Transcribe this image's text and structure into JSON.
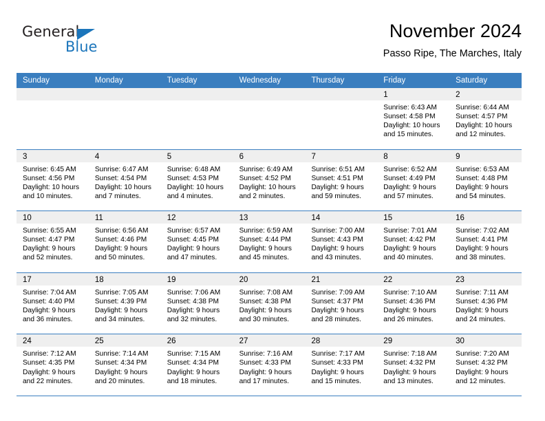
{
  "brand": {
    "word_one": "General",
    "word_two": "Blue",
    "triangle_icon": "triangle-icon",
    "accent_color": "#1b75bb"
  },
  "header": {
    "title": "November 2024",
    "subtitle": "Passo Ripe, The Marches, Italy"
  },
  "colors": {
    "header_band": "#3a7ebf",
    "day_number_band": "#efefef",
    "grid_line": "#3a7ebf",
    "text": "#000000"
  },
  "calendar": {
    "weekday_headers": [
      "Sunday",
      "Monday",
      "Tuesday",
      "Wednesday",
      "Thursday",
      "Friday",
      "Saturday"
    ],
    "weeks": [
      [
        {
          "date": "",
          "sunrise": "",
          "sunset": "",
          "daylight_line1": "",
          "daylight_line2": "",
          "empty": true
        },
        {
          "date": "",
          "sunrise": "",
          "sunset": "",
          "daylight_line1": "",
          "daylight_line2": "",
          "empty": true
        },
        {
          "date": "",
          "sunrise": "",
          "sunset": "",
          "daylight_line1": "",
          "daylight_line2": "",
          "empty": true
        },
        {
          "date": "",
          "sunrise": "",
          "sunset": "",
          "daylight_line1": "",
          "daylight_line2": "",
          "empty": true
        },
        {
          "date": "",
          "sunrise": "",
          "sunset": "",
          "daylight_line1": "",
          "daylight_line2": "",
          "empty": true
        },
        {
          "date": "1",
          "sunrise": "Sunrise: 6:43 AM",
          "sunset": "Sunset: 4:58 PM",
          "daylight_line1": "Daylight: 10 hours",
          "daylight_line2": "and 15 minutes.",
          "empty": false
        },
        {
          "date": "2",
          "sunrise": "Sunrise: 6:44 AM",
          "sunset": "Sunset: 4:57 PM",
          "daylight_line1": "Daylight: 10 hours",
          "daylight_line2": "and 12 minutes.",
          "empty": false
        }
      ],
      [
        {
          "date": "3",
          "sunrise": "Sunrise: 6:45 AM",
          "sunset": "Sunset: 4:56 PM",
          "daylight_line1": "Daylight: 10 hours",
          "daylight_line2": "and 10 minutes.",
          "empty": false
        },
        {
          "date": "4",
          "sunrise": "Sunrise: 6:47 AM",
          "sunset": "Sunset: 4:54 PM",
          "daylight_line1": "Daylight: 10 hours",
          "daylight_line2": "and 7 minutes.",
          "empty": false
        },
        {
          "date": "5",
          "sunrise": "Sunrise: 6:48 AM",
          "sunset": "Sunset: 4:53 PM",
          "daylight_line1": "Daylight: 10 hours",
          "daylight_line2": "and 4 minutes.",
          "empty": false
        },
        {
          "date": "6",
          "sunrise": "Sunrise: 6:49 AM",
          "sunset": "Sunset: 4:52 PM",
          "daylight_line1": "Daylight: 10 hours",
          "daylight_line2": "and 2 minutes.",
          "empty": false
        },
        {
          "date": "7",
          "sunrise": "Sunrise: 6:51 AM",
          "sunset": "Sunset: 4:51 PM",
          "daylight_line1": "Daylight: 9 hours",
          "daylight_line2": "and 59 minutes.",
          "empty": false
        },
        {
          "date": "8",
          "sunrise": "Sunrise: 6:52 AM",
          "sunset": "Sunset: 4:49 PM",
          "daylight_line1": "Daylight: 9 hours",
          "daylight_line2": "and 57 minutes.",
          "empty": false
        },
        {
          "date": "9",
          "sunrise": "Sunrise: 6:53 AM",
          "sunset": "Sunset: 4:48 PM",
          "daylight_line1": "Daylight: 9 hours",
          "daylight_line2": "and 54 minutes.",
          "empty": false
        }
      ],
      [
        {
          "date": "10",
          "sunrise": "Sunrise: 6:55 AM",
          "sunset": "Sunset: 4:47 PM",
          "daylight_line1": "Daylight: 9 hours",
          "daylight_line2": "and 52 minutes.",
          "empty": false
        },
        {
          "date": "11",
          "sunrise": "Sunrise: 6:56 AM",
          "sunset": "Sunset: 4:46 PM",
          "daylight_line1": "Daylight: 9 hours",
          "daylight_line2": "and 50 minutes.",
          "empty": false
        },
        {
          "date": "12",
          "sunrise": "Sunrise: 6:57 AM",
          "sunset": "Sunset: 4:45 PM",
          "daylight_line1": "Daylight: 9 hours",
          "daylight_line2": "and 47 minutes.",
          "empty": false
        },
        {
          "date": "13",
          "sunrise": "Sunrise: 6:59 AM",
          "sunset": "Sunset: 4:44 PM",
          "daylight_line1": "Daylight: 9 hours",
          "daylight_line2": "and 45 minutes.",
          "empty": false
        },
        {
          "date": "14",
          "sunrise": "Sunrise: 7:00 AM",
          "sunset": "Sunset: 4:43 PM",
          "daylight_line1": "Daylight: 9 hours",
          "daylight_line2": "and 43 minutes.",
          "empty": false
        },
        {
          "date": "15",
          "sunrise": "Sunrise: 7:01 AM",
          "sunset": "Sunset: 4:42 PM",
          "daylight_line1": "Daylight: 9 hours",
          "daylight_line2": "and 40 minutes.",
          "empty": false
        },
        {
          "date": "16",
          "sunrise": "Sunrise: 7:02 AM",
          "sunset": "Sunset: 4:41 PM",
          "daylight_line1": "Daylight: 9 hours",
          "daylight_line2": "and 38 minutes.",
          "empty": false
        }
      ],
      [
        {
          "date": "17",
          "sunrise": "Sunrise: 7:04 AM",
          "sunset": "Sunset: 4:40 PM",
          "daylight_line1": "Daylight: 9 hours",
          "daylight_line2": "and 36 minutes.",
          "empty": false
        },
        {
          "date": "18",
          "sunrise": "Sunrise: 7:05 AM",
          "sunset": "Sunset: 4:39 PM",
          "daylight_line1": "Daylight: 9 hours",
          "daylight_line2": "and 34 minutes.",
          "empty": false
        },
        {
          "date": "19",
          "sunrise": "Sunrise: 7:06 AM",
          "sunset": "Sunset: 4:38 PM",
          "daylight_line1": "Daylight: 9 hours",
          "daylight_line2": "and 32 minutes.",
          "empty": false
        },
        {
          "date": "20",
          "sunrise": "Sunrise: 7:08 AM",
          "sunset": "Sunset: 4:38 PM",
          "daylight_line1": "Daylight: 9 hours",
          "daylight_line2": "and 30 minutes.",
          "empty": false
        },
        {
          "date": "21",
          "sunrise": "Sunrise: 7:09 AM",
          "sunset": "Sunset: 4:37 PM",
          "daylight_line1": "Daylight: 9 hours",
          "daylight_line2": "and 28 minutes.",
          "empty": false
        },
        {
          "date": "22",
          "sunrise": "Sunrise: 7:10 AM",
          "sunset": "Sunset: 4:36 PM",
          "daylight_line1": "Daylight: 9 hours",
          "daylight_line2": "and 26 minutes.",
          "empty": false
        },
        {
          "date": "23",
          "sunrise": "Sunrise: 7:11 AM",
          "sunset": "Sunset: 4:36 PM",
          "daylight_line1": "Daylight: 9 hours",
          "daylight_line2": "and 24 minutes.",
          "empty": false
        }
      ],
      [
        {
          "date": "24",
          "sunrise": "Sunrise: 7:12 AM",
          "sunset": "Sunset: 4:35 PM",
          "daylight_line1": "Daylight: 9 hours",
          "daylight_line2": "and 22 minutes.",
          "empty": false
        },
        {
          "date": "25",
          "sunrise": "Sunrise: 7:14 AM",
          "sunset": "Sunset: 4:34 PM",
          "daylight_line1": "Daylight: 9 hours",
          "daylight_line2": "and 20 minutes.",
          "empty": false
        },
        {
          "date": "26",
          "sunrise": "Sunrise: 7:15 AM",
          "sunset": "Sunset: 4:34 PM",
          "daylight_line1": "Daylight: 9 hours",
          "daylight_line2": "and 18 minutes.",
          "empty": false
        },
        {
          "date": "27",
          "sunrise": "Sunrise: 7:16 AM",
          "sunset": "Sunset: 4:33 PM",
          "daylight_line1": "Daylight: 9 hours",
          "daylight_line2": "and 17 minutes.",
          "empty": false
        },
        {
          "date": "28",
          "sunrise": "Sunrise: 7:17 AM",
          "sunset": "Sunset: 4:33 PM",
          "daylight_line1": "Daylight: 9 hours",
          "daylight_line2": "and 15 minutes.",
          "empty": false
        },
        {
          "date": "29",
          "sunrise": "Sunrise: 7:18 AM",
          "sunset": "Sunset: 4:32 PM",
          "daylight_line1": "Daylight: 9 hours",
          "daylight_line2": "and 13 minutes.",
          "empty": false
        },
        {
          "date": "30",
          "sunrise": "Sunrise: 7:20 AM",
          "sunset": "Sunset: 4:32 PM",
          "daylight_line1": "Daylight: 9 hours",
          "daylight_line2": "and 12 minutes.",
          "empty": false
        }
      ]
    ]
  }
}
